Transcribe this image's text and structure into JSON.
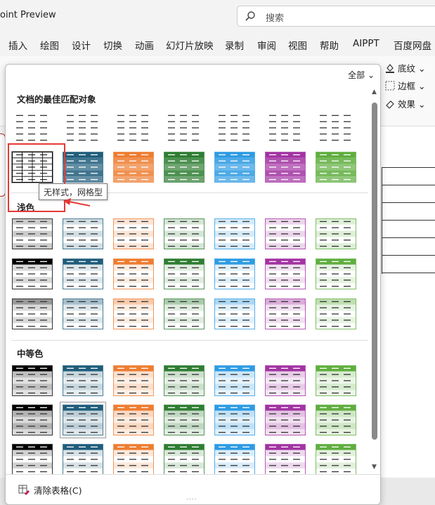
{
  "titlebar": {
    "app_title": "oint Preview",
    "search_placeholder": "搜索"
  },
  "menu": {
    "items": [
      "插入",
      "绘图",
      "设计",
      "切换",
      "动画",
      "幻灯片放映",
      "录制",
      "审阅",
      "视图",
      "帮助",
      "AIPPT",
      "百度网盘"
    ]
  },
  "ribbon": {
    "shading": "底纹",
    "borders": "边框",
    "effects": "效果"
  },
  "dropdown": {
    "filter_label": "全部",
    "sections": [
      {
        "title": "文档的最佳匹配对象"
      },
      {
        "title": "浅色"
      },
      {
        "title": "中等色"
      }
    ],
    "tooltip": "无样式，网格型",
    "clear_label": "清除表格(C)",
    "grip": "....",
    "palette": [
      "#000000",
      "#1f5d7b",
      "#ed7d31",
      "#2e7d32",
      "#2e9be3",
      "#a233a2",
      "#5fae3e"
    ]
  },
  "colors": {
    "highlight": "#e53935"
  }
}
